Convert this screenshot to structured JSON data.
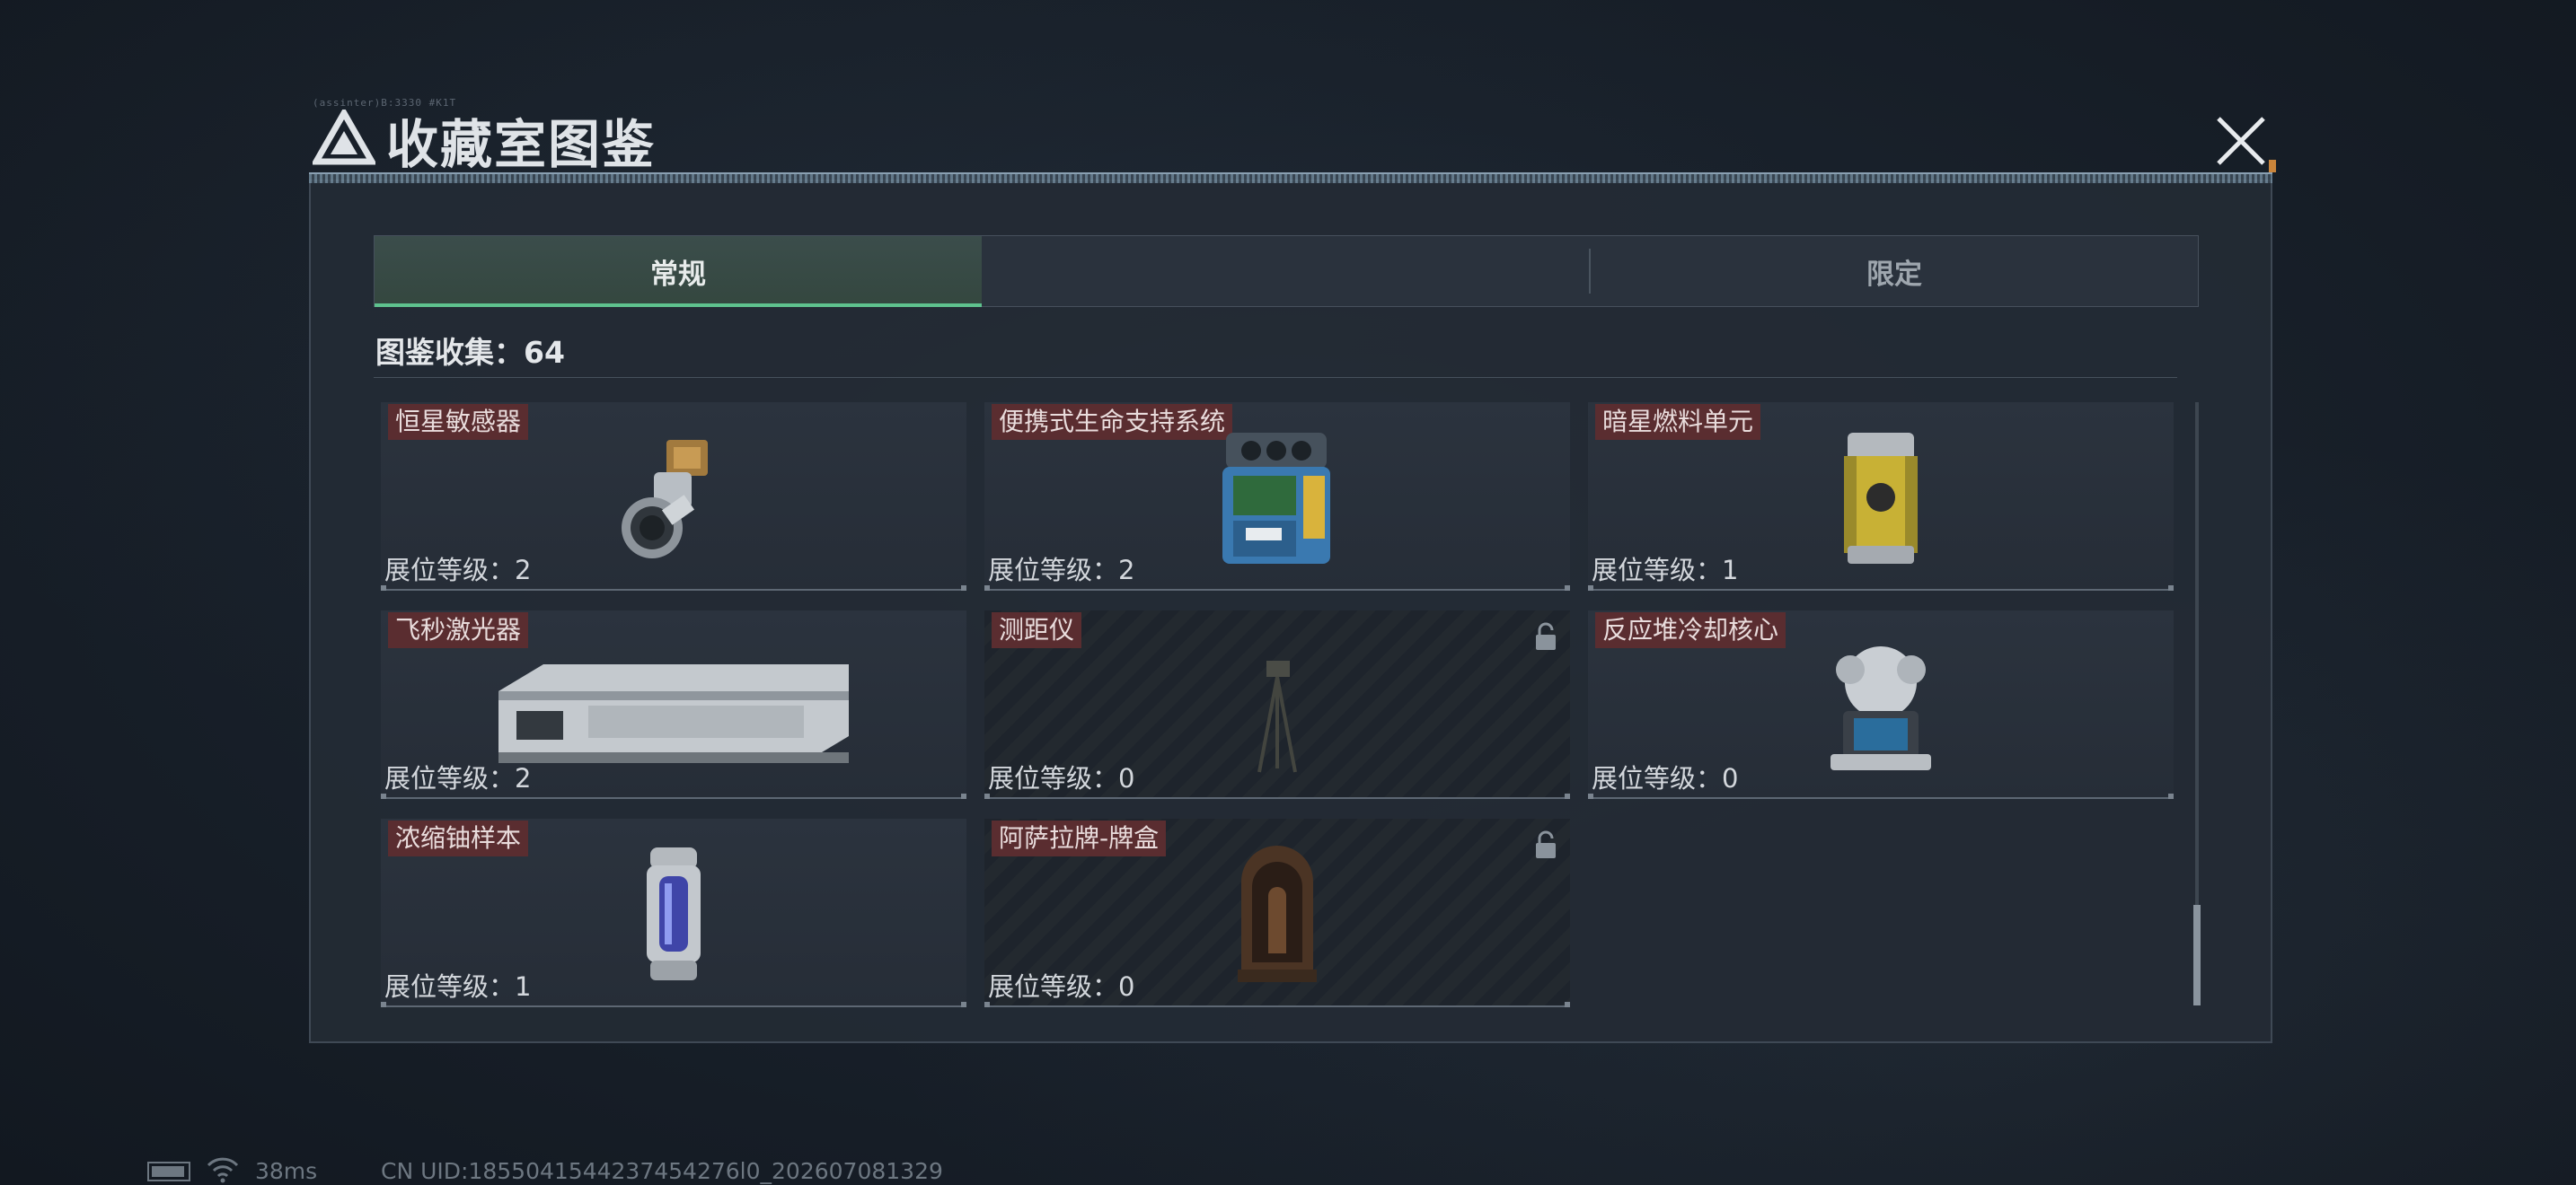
{
  "header": {
    "tiny_text": "(assinter)B:3330 #K1T",
    "title": "收藏室图鉴"
  },
  "tabs": [
    {
      "label": "常规",
      "active": true
    },
    {
      "label": "",
      "active": false
    },
    {
      "label": "限定",
      "active": false
    }
  ],
  "collection": {
    "label": "图鉴收集：64"
  },
  "items": [
    {
      "name": "恒星敏感器",
      "level": "展位等级：2",
      "locked": false,
      "icon": "star-sensor"
    },
    {
      "name": "便携式生命支持系统",
      "level": "展位等级：2",
      "locked": false,
      "icon": "life-support-pack"
    },
    {
      "name": "暗星燃料单元",
      "level": "展位等级：1",
      "locked": false,
      "icon": "fuel-canister"
    },
    {
      "name": "飞秒激光器",
      "level": "展位等级：2",
      "locked": false,
      "icon": "laser-device"
    },
    {
      "name": "测距仪",
      "level": "展位等级：0",
      "locked": true,
      "icon": "tripod"
    },
    {
      "name": "反应堆冷却核心",
      "level": "展位等级：0",
      "locked": false,
      "icon": "cooling-core"
    },
    {
      "name": "浓缩铀样本",
      "level": "展位等级：1",
      "locked": false,
      "icon": "uranium-capsule"
    },
    {
      "name": "阿萨拉牌-牌盒",
      "level": "展位等级：0",
      "locked": true,
      "icon": "card-box"
    }
  ],
  "footer": {
    "ping": "38ms",
    "uid": "CN UID:1855041544237454276l0_202607081329"
  },
  "colors": {
    "active_tab_accent": "#5ec28e",
    "name_tag_bg": "#5a2d30"
  }
}
